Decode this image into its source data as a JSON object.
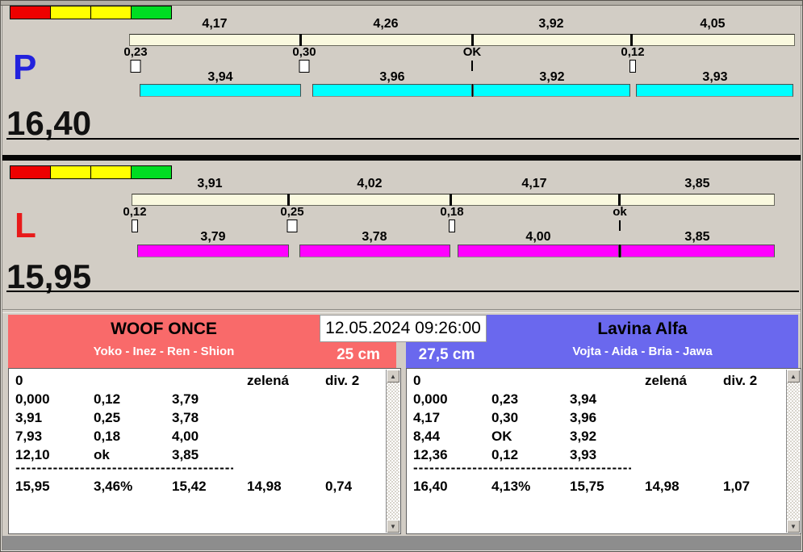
{
  "datetime": "12.05.2024 09:26:00",
  "icons": {
    "arrow_up": "▲",
    "arrow_down": "▼"
  },
  "colors": {
    "lane_right_bar": "#00FFFF",
    "lane_left_bar": "#FF00FF",
    "split_bar": "#FAF9DF",
    "team_left_bg": "#F96A6A",
    "team_right_bg": "#6A68EE",
    "lane_right_letter": "#2222DD",
    "lane_left_letter": "#E81A1A",
    "status_strip": [
      "#EE0000",
      "#FFFF00",
      "#FFFF00",
      "#00DD22"
    ]
  },
  "lanes": [
    {
      "letter": "P",
      "total": "16,40",
      "splits": [
        {
          "time": "4,17",
          "crossing": "0,23",
          "mark": "box",
          "run": "3,94"
        },
        {
          "time": "4,26",
          "crossing": "0,30",
          "mark": "box",
          "run": "3,96"
        },
        {
          "time": "3,92",
          "crossing": "OK",
          "mark": "tick-line",
          "run": "3,92"
        },
        {
          "time": "4,05",
          "crossing": "0,12",
          "mark": "narrow-box",
          "run": "3,93"
        }
      ]
    },
    {
      "letter": "L",
      "total": "15,95",
      "splits": [
        {
          "time": "3,91",
          "crossing": "0,12",
          "mark": "narrow-box",
          "run": "3,79"
        },
        {
          "time": "4,02",
          "crossing": "0,25",
          "mark": "box",
          "run": "3,78"
        },
        {
          "time": "4,17",
          "crossing": "0,18",
          "mark": "narrow-box",
          "run": "4,00"
        },
        {
          "time": "3,85",
          "crossing": "ok",
          "mark": "tick-line",
          "run": "3,85"
        }
      ]
    }
  ],
  "teams": [
    {
      "name": "WOOF ONCE",
      "members": "Yoko - Inez - Ren - Shion",
      "height": "25 cm",
      "color": "#F96A6A",
      "rows": [
        [
          "0",
          "",
          "",
          "zelená",
          "div. 2"
        ],
        [
          "0,000",
          "0,12",
          "3,79",
          "",
          ""
        ],
        [
          "3,91",
          "0,25",
          "3,78",
          "",
          ""
        ],
        [
          "7,93",
          "0,18",
          "4,00",
          "",
          ""
        ],
        [
          "12,10",
          "ok",
          "3,85",
          "",
          ""
        ]
      ],
      "separator": "----------------------------------------------",
      "totals": [
        "15,95",
        "3,46%",
        "15,42",
        "14,98",
        "0,74"
      ]
    },
    {
      "name": "Lavina Alfa",
      "members": "Vojta - Aida - Bria - Jawa",
      "height": "27,5 cm",
      "color": "#6A68EE",
      "rows": [
        [
          "0",
          "",
          "",
          "zelená",
          "div. 2"
        ],
        [
          "0,000",
          "0,23",
          "3,94",
          "",
          ""
        ],
        [
          "4,17",
          "0,30",
          "3,96",
          "",
          ""
        ],
        [
          "8,44",
          "OK",
          "3,92",
          "",
          ""
        ],
        [
          "12,36",
          "0,12",
          "3,93",
          "",
          ""
        ]
      ],
      "separator": "----------------------------------------------",
      "totals": [
        "16,40",
        "4,13%",
        "15,75",
        "14,98",
        "1,07"
      ]
    }
  ]
}
